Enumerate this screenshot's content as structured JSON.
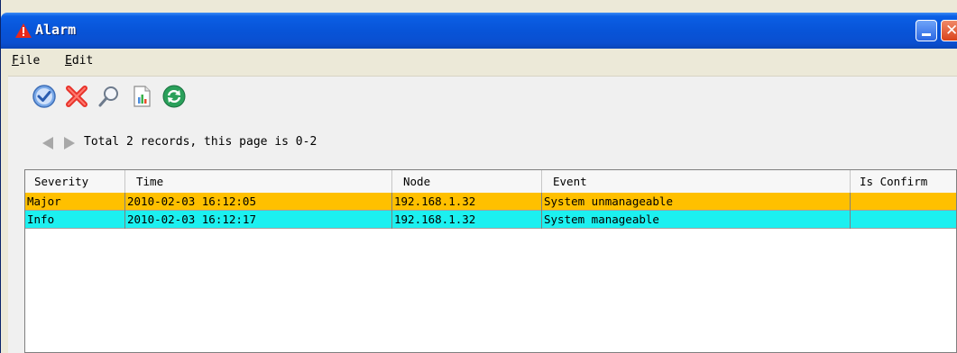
{
  "window": {
    "title": "Alarm",
    "icon": "alarm-warning-icon"
  },
  "menu": {
    "file": "File",
    "edit": "Edit"
  },
  "toolbar": {
    "tools": [
      "confirm-icon",
      "delete-icon",
      "search-icon",
      "report-icon",
      "refresh-icon"
    ]
  },
  "pager": {
    "records_text": "Total 2 records, this page is 0-2"
  },
  "table": {
    "columns": [
      "Severity",
      "Time",
      "Node",
      "Event",
      "Is Confirm"
    ],
    "rows": [
      {
        "severity": "Major",
        "time": "2010-02-03 16:12:05",
        "node": "192.168.1.32",
        "event": "System unmanageable",
        "confirm": "",
        "color": "#ffc000"
      },
      {
        "severity": "Info",
        "time": "2010-02-03 16:12:17",
        "node": "192.168.1.32",
        "event": "System manageable",
        "confirm": "",
        "color": "#1cf0f0"
      }
    ]
  },
  "colors": {
    "titlebar": "#0854d8",
    "major": "#ffc000",
    "info": "#1cf0f0"
  }
}
